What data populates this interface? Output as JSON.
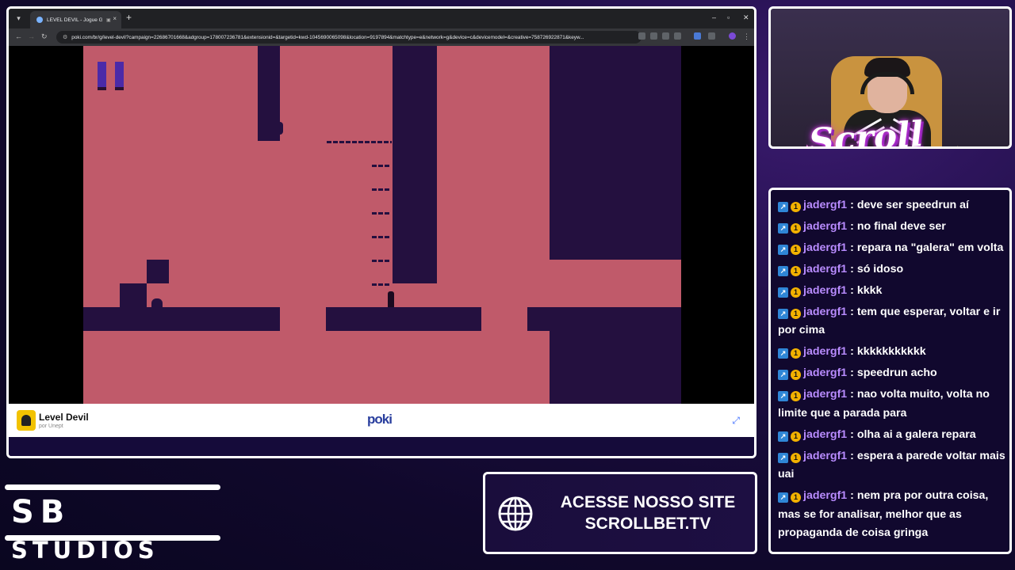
{
  "browser": {
    "tab_title": "LEVEL DEVIL - Jogue Grátis",
    "tab_close": "×",
    "new_tab": "+",
    "url": "poki.com/br/g/level-devil?campaign=22686701668&adgroup=178007236781&extensionid=&targetid=kwd-1045690065098&location=9197894&matchtype=e&network=g&device=c&devicemodel=&creative=758726922871&keyw...",
    "window_controls": [
      "–",
      "▫",
      "✕"
    ]
  },
  "game": {
    "name": "Level Devil",
    "author": "por Unept",
    "platform_logo": "poki"
  },
  "webcam": {
    "logo_text": "Scroll"
  },
  "chat": {
    "messages": [
      {
        "user": "jadergf1",
        "text": "deve ser speedrun aí"
      },
      {
        "user": "jadergf1",
        "text": "no final deve ser"
      },
      {
        "user": "jadergf1",
        "text": "repara na \"galera\" em volta"
      },
      {
        "user": "jadergf1",
        "text": "só idoso"
      },
      {
        "user": "jadergf1",
        "text": "kkkk"
      },
      {
        "user": "jadergf1",
        "text": "tem que esperar, voltar e ir por cima"
      },
      {
        "user": "jadergf1",
        "text": "kkkkkkkkkkk"
      },
      {
        "user": "jadergf1",
        "text": "speedrun acho"
      },
      {
        "user": "jadergf1",
        "text": "nao volta muito, volta no limite que a parada para"
      },
      {
        "user": "jadergf1",
        "text": "olha ai a galera repara"
      },
      {
        "user": "jadergf1",
        "text": "espera a parede voltar mais uai"
      },
      {
        "user": "jadergf1",
        "text": "nem pra por outra coisa, mas se for analisar, melhor que as propaganda de coisa gringa"
      }
    ]
  },
  "branding": {
    "sb": "SB",
    "studios": "STUDIOS"
  },
  "site_banner": {
    "line1": "ACESSE NOSSO SITE",
    "line2": "SCROLLBET.TV"
  },
  "colors": {
    "game_background": "#c05a6a",
    "game_dark": "#24103f",
    "chat_username": "#b98cff"
  }
}
